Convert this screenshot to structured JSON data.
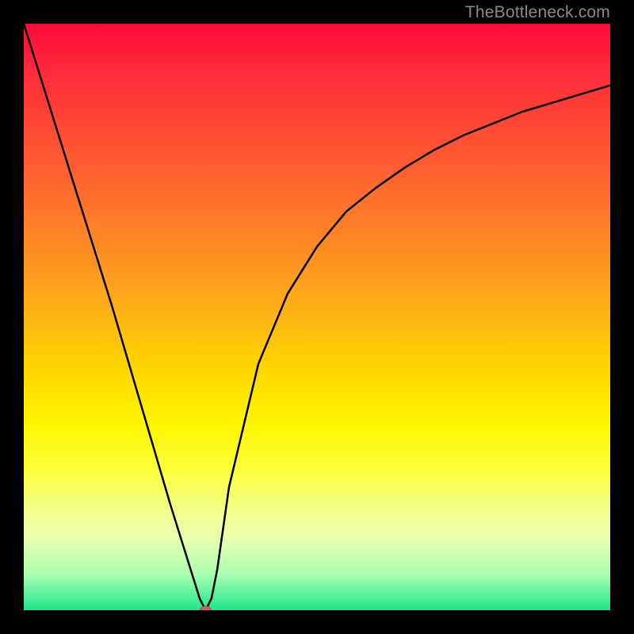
{
  "attribution": "TheBottleneck.com",
  "chart_data": {
    "type": "line",
    "title": "",
    "xlabel": "",
    "ylabel": "",
    "xlim": [
      0,
      100
    ],
    "ylim": [
      0,
      100
    ],
    "curve": {
      "x": [
        0,
        5,
        10,
        15,
        20,
        25,
        30,
        31,
        32,
        33,
        34,
        35,
        40,
        45,
        50,
        55,
        60,
        65,
        70,
        75,
        80,
        85,
        90,
        95,
        100
      ],
      "y": [
        100,
        84,
        68,
        52,
        35,
        18,
        2,
        0,
        2,
        7,
        14,
        21,
        42,
        54,
        62,
        68,
        72,
        75.5,
        78.5,
        81,
        83,
        85,
        86.5,
        88,
        89.5
      ]
    },
    "marker": {
      "x": 31,
      "y": 0
    },
    "background": "rainbow-red-to-green",
    "grid": false,
    "legend": false
  }
}
